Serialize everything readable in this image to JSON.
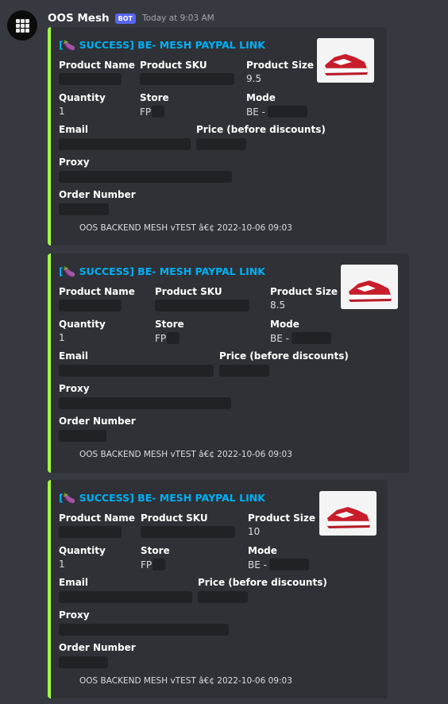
{
  "message": {
    "username": "OOS Mesh",
    "bot_tag": "BOT",
    "timestamp": "Today at 9:03 AM"
  },
  "colors": {
    "background": "#36393f",
    "embed_bg": "#2f3136",
    "embed_accent": "#a1ff41",
    "title_link": "#00b0f4",
    "bot_tag": "#5865f2",
    "redaction": "#202225"
  },
  "embeds": [
    {
      "title_icon": "🍆",
      "title": "[🍆 SUCCESS] BE- MESH PAYPAL LINK",
      "labels": {
        "product_name": "Product Name",
        "product_sku": "Product SKU",
        "product_size": "Product Size",
        "quantity": "Quantity",
        "store": "Store",
        "mode": "Mode",
        "email": "Email",
        "price": "Price (before discounts)",
        "proxy": "Proxy",
        "order_number": "Order Number"
      },
      "product_size": "9.5",
      "quantity": "1",
      "store_prefix": "FP",
      "mode_prefix": "BE -",
      "thumbnail": "red-sneaker-thumbnail",
      "footer": "OOS BACKEND MESH vTEST â€¢ 2022-10-06 09:03"
    },
    {
      "title_icon": "🍆",
      "title": "[🍆 SUCCESS] BE- MESH PAYPAL LINK",
      "labels": {
        "product_name": "Product Name",
        "product_sku": "Product SKU",
        "product_size": "Product Size",
        "quantity": "Quantity",
        "store": "Store",
        "mode": "Mode",
        "email": "Email",
        "price": "Price (before discounts)",
        "proxy": "Proxy",
        "order_number": "Order Number"
      },
      "product_size": "8.5",
      "quantity": "1",
      "store_prefix": "FP",
      "mode_prefix": "BE -",
      "thumbnail": "red-sneaker-thumbnail",
      "footer": "OOS BACKEND MESH vTEST â€¢ 2022-10-06 09:03"
    },
    {
      "title_icon": "🍆",
      "title": "[🍆 SUCCESS] BE- MESH PAYPAL LINK",
      "labels": {
        "product_name": "Product Name",
        "product_sku": "Product SKU",
        "product_size": "Product Size",
        "quantity": "Quantity",
        "store": "Store",
        "mode": "Mode",
        "email": "Email",
        "price": "Price (before discounts)",
        "proxy": "Proxy",
        "order_number": "Order Number"
      },
      "product_size": "10",
      "quantity": "1",
      "store_prefix": "FP",
      "mode_prefix": "BE -",
      "thumbnail": "red-sneaker-thumbnail",
      "footer": "OOS BACKEND MESH vTEST â€¢ 2022-10-06 09:03"
    }
  ]
}
